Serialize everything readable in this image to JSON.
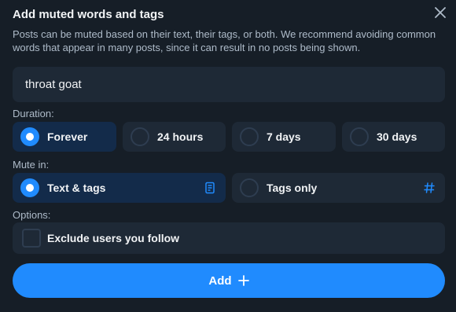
{
  "dialog": {
    "title": "Add muted words and tags",
    "description": "Posts can be muted based on their text, their tags, or both. We recommend avoiding common words that appear in many posts, since it can result in no posts being shown.",
    "close_icon": "close-icon"
  },
  "input": {
    "value": "throat goat",
    "placeholder": ""
  },
  "duration": {
    "label": "Duration:",
    "options": [
      {
        "label": "Forever",
        "selected": true
      },
      {
        "label": "24 hours",
        "selected": false
      },
      {
        "label": "7 days",
        "selected": false
      },
      {
        "label": "30 days",
        "selected": false
      }
    ]
  },
  "mute_in": {
    "label": "Mute in:",
    "options": [
      {
        "label": "Text & tags",
        "selected": true,
        "icon": "document-icon"
      },
      {
        "label": "Tags only",
        "selected": false,
        "icon": "hashtag-icon"
      }
    ]
  },
  "options": {
    "label": "Options:",
    "exclude_following": {
      "label": "Exclude users you follow",
      "checked": false
    }
  },
  "add_button": {
    "label": "Add",
    "icon": "plus-icon"
  },
  "colors": {
    "background": "#161e27",
    "accent": "#208bfe",
    "selected_bg": "#132b4a",
    "option_bg": "#1e2936"
  }
}
